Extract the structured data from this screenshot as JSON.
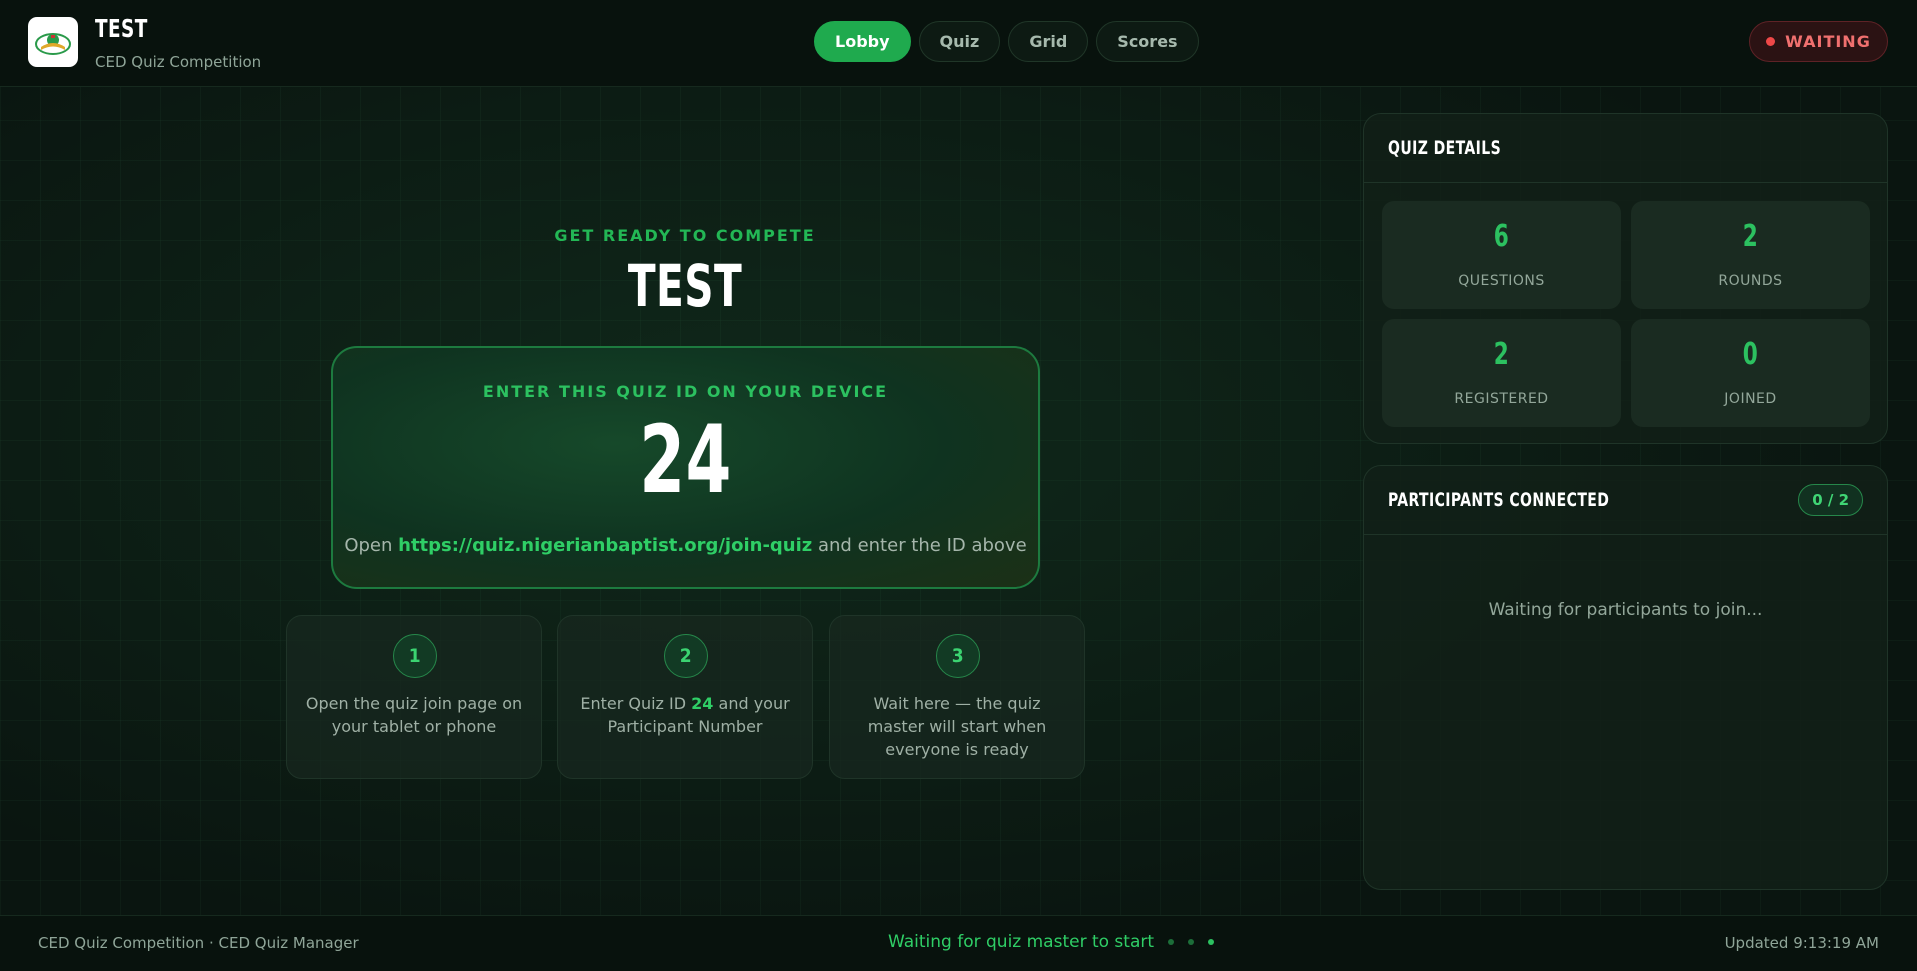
{
  "header": {
    "title": "TEST",
    "subtitle": "CED Quiz Competition",
    "logo_icon": "ced-logo-icon",
    "nav": [
      {
        "label": "Lobby",
        "active": true
      },
      {
        "label": "Quiz",
        "active": false
      },
      {
        "label": "Grid",
        "active": false
      },
      {
        "label": "Scores",
        "active": false
      }
    ],
    "status": "WAITING"
  },
  "main": {
    "eyebrow": "GET READY TO COMPETE",
    "title": "TEST",
    "id_card": {
      "label": "ENTER THIS QUIZ ID ON YOUR DEVICE",
      "quiz_id": "24",
      "instr_prefix": "Open ",
      "instr_link": "https://quiz.nigerianbaptist.org/join-quiz",
      "instr_suffix": " and enter the ID above"
    },
    "steps": [
      {
        "num": "1",
        "text": "Open the quiz join page on your tablet or phone"
      },
      {
        "num": "2",
        "text_prefix": "Enter Quiz ID ",
        "highlight": "24",
        "text_suffix": " and your Participant Number"
      },
      {
        "num": "3",
        "text": "Wait here — the quiz master will start when everyone is ready"
      }
    ]
  },
  "quiz_details": {
    "title": "QUIZ DETAILS",
    "stats": [
      {
        "value": "6",
        "label": "QUESTIONS"
      },
      {
        "value": "2",
        "label": "ROUNDS"
      },
      {
        "value": "2",
        "label": "REGISTERED"
      },
      {
        "value": "0",
        "label": "JOINED"
      }
    ]
  },
  "participants": {
    "title": "PARTICIPANTS CONNECTED",
    "count": "0 / 2",
    "empty_text": "Waiting for participants to join..."
  },
  "footer": {
    "left": "CED Quiz Competition · CED Quiz Manager",
    "center": "Waiting for quiz master to start",
    "right": "Updated 9:13:19 AM"
  },
  "colors": {
    "accent": "#1faa4e",
    "accent_text": "#2cc160",
    "waiting_red": "#ee4848",
    "background": "#0a1510"
  }
}
